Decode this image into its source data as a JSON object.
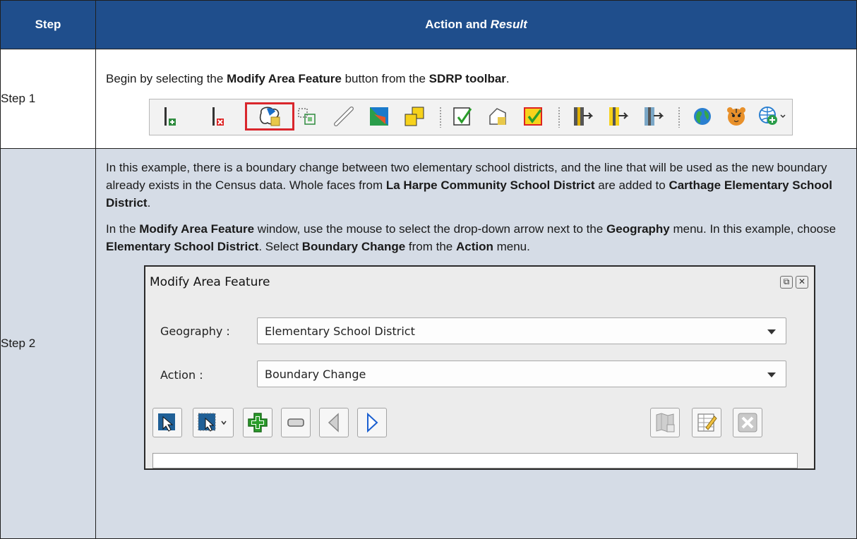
{
  "header": {
    "step": "Step",
    "action": "Action and ",
    "result": "Result"
  },
  "steps": [
    {
      "label": "Step 1",
      "text": [
        {
          "t": "Begin by selecting the ",
          "b": false
        },
        {
          "t": "Modify Area Feature",
          "b": true
        },
        {
          "t": " button from the ",
          "b": false
        },
        {
          "t": "SDRP toolbar",
          "b": true
        },
        {
          "t": ".",
          "b": false
        }
      ]
    },
    {
      "label": "Step 2",
      "para1": [
        {
          "t": "In this example, there is a boundary change between two elementary school districts, and the line that will be used as the new boundary already exists in the Census data. Whole faces from ",
          "b": false
        },
        {
          "t": "La Harpe Community School District",
          "b": true
        },
        {
          "t": " are added to ",
          "b": false
        },
        {
          "t": "Carthage Elementary School District",
          "b": true
        },
        {
          "t": ".",
          "b": false
        }
      ],
      "para2": [
        {
          "t": "In the ",
          "b": false
        },
        {
          "t": "Modify Area Feature",
          "b": true
        },
        {
          "t": " window, use the mouse to select the drop-down arrow next to the ",
          "b": false
        },
        {
          "t": "Geography",
          "b": true
        },
        {
          "t": " menu. In this example, choose ",
          "b": false
        },
        {
          "t": "Elementary School District",
          "b": true
        },
        {
          "t": ". Select ",
          "b": false
        },
        {
          "t": "Boundary Change",
          "b": true
        },
        {
          "t": " from the ",
          "b": false
        },
        {
          "t": "Action",
          "b": true
        },
        {
          "t": " menu.",
          "b": false
        }
      ]
    }
  ],
  "window": {
    "title": "Modify Area Feature",
    "geography_label": "Geography :",
    "geography_value": "Elementary School District",
    "action_label": "Action :",
    "action_value": "Boundary Change"
  },
  "colors": {
    "header_bg": "#1f4e8c",
    "row2_bg": "#d5dce6",
    "highlight": "#d9262c"
  }
}
